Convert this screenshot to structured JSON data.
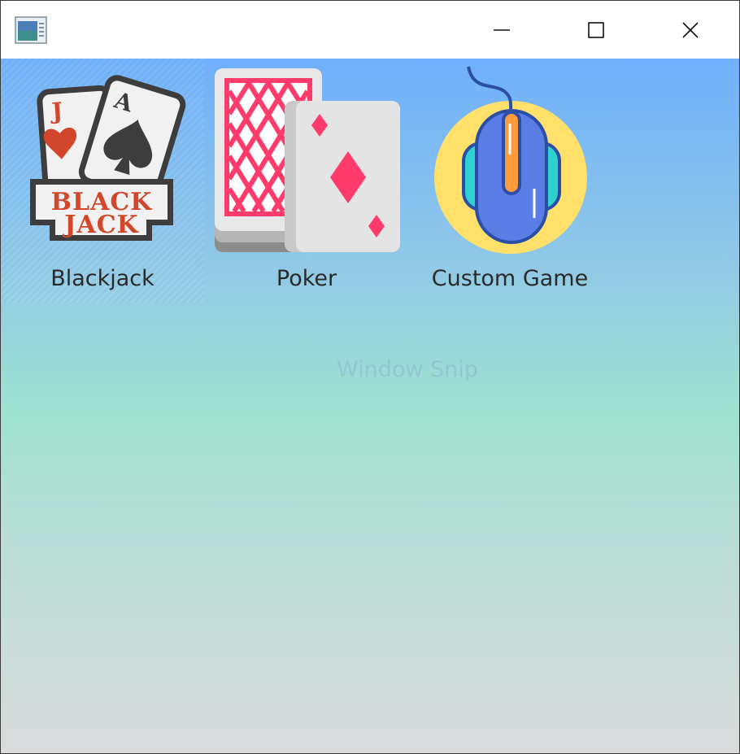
{
  "window": {
    "title": "",
    "app_icon": "window-app-icon"
  },
  "titlebar": {
    "buttons": [
      {
        "name": "minimize-icon"
      },
      {
        "name": "maximize-icon"
      },
      {
        "name": "close-icon"
      }
    ]
  },
  "games": [
    {
      "label": "Blackjack",
      "icon": "blackjack-cards-icon",
      "selected": true
    },
    {
      "label": "Poker",
      "icon": "playing-cards-icon",
      "selected": false
    },
    {
      "label": "Custom Game",
      "icon": "computer-mouse-icon",
      "selected": false
    }
  ],
  "watermark": {
    "text": "Window Snip"
  },
  "colors": {
    "gradient_top": "#6fb0fb",
    "gradient_mid": "#9fe2cf",
    "gradient_bottom": "#dadbdc",
    "label_text": "#2a2a2a"
  }
}
